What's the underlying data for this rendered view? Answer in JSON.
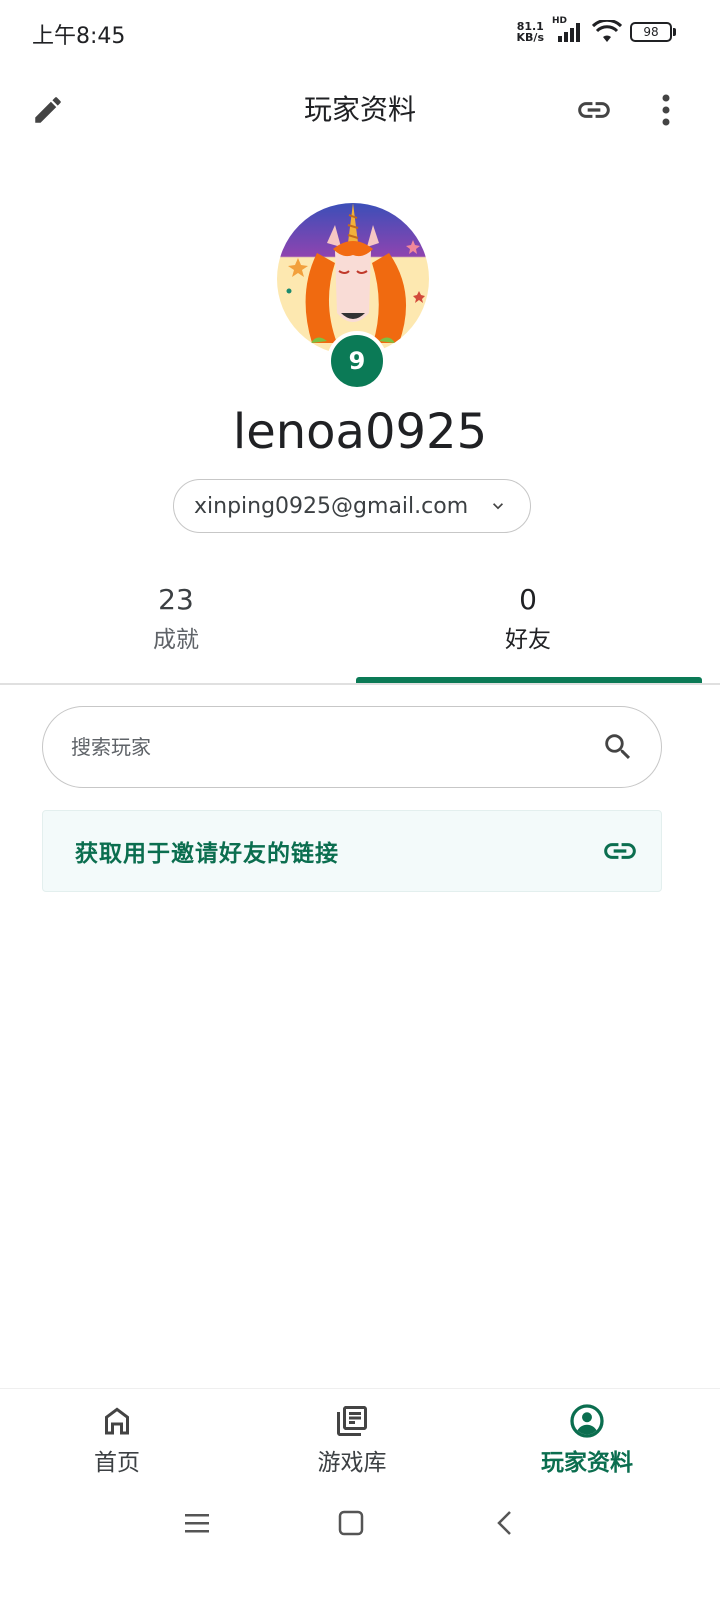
{
  "status_bar": {
    "time": "上午8:45",
    "net_speed_value": "81.1",
    "net_speed_unit": "KB/s",
    "network_type": "HD",
    "battery": "98"
  },
  "app_bar": {
    "title": "玩家资料",
    "edit_icon": "pencil-icon",
    "link_icon": "link-icon",
    "more_icon": "more-vert-icon"
  },
  "profile": {
    "level": "9",
    "username": "lenoa0925",
    "account_email": "xinping0925@gmail.com"
  },
  "stats": {
    "tabs": [
      {
        "value": "23",
        "label": "成就",
        "active": false
      },
      {
        "value": "0",
        "label": "好友",
        "active": true
      }
    ]
  },
  "friends": {
    "search_placeholder": "搜索玩家",
    "invite_link_label": "获取用于邀请好友的链接"
  },
  "bottom_nav": {
    "items": [
      {
        "label": "首页",
        "icon": "home-icon",
        "active": false
      },
      {
        "label": "游戏库",
        "icon": "library-icon",
        "active": false
      },
      {
        "label": "玩家资料",
        "icon": "profile-icon",
        "active": true
      }
    ]
  },
  "colors": {
    "accent": "#0b7a56",
    "accent_text": "#0b6e4f",
    "invite_bg": "#f3fafa"
  }
}
